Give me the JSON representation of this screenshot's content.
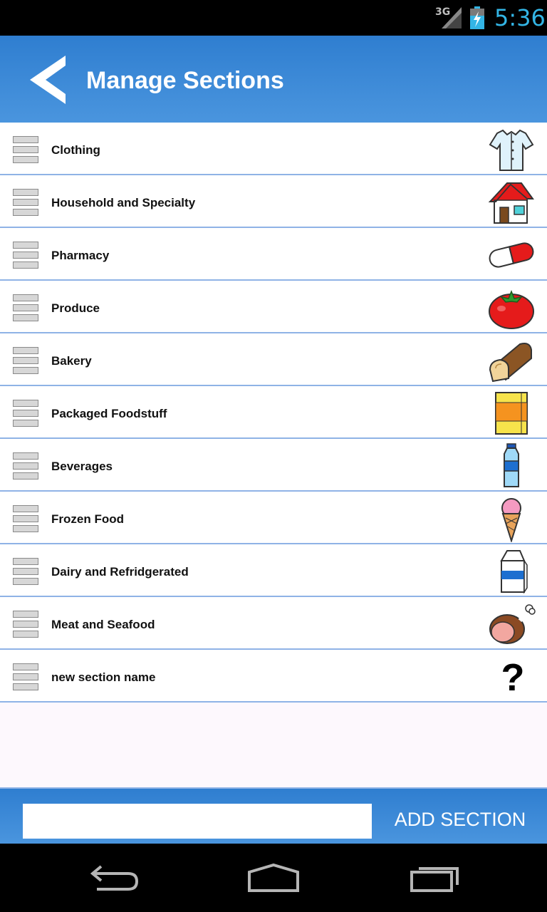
{
  "status": {
    "network": "3G",
    "time": "5:36"
  },
  "header": {
    "title": "Manage Sections",
    "back_icon": "back-arrow-icon"
  },
  "sections": [
    {
      "label": "Clothing",
      "icon": "shirt-icon"
    },
    {
      "label": "Household and Specialty",
      "icon": "house-icon"
    },
    {
      "label": "Pharmacy",
      "icon": "pill-icon"
    },
    {
      "label": "Produce",
      "icon": "tomato-icon"
    },
    {
      "label": "Bakery",
      "icon": "bread-icon"
    },
    {
      "label": "Packaged Foodstuff",
      "icon": "cereal-box-icon"
    },
    {
      "label": "Beverages",
      "icon": "water-bottle-icon"
    },
    {
      "label": "Frozen Food",
      "icon": "ice-cream-icon"
    },
    {
      "label": "Dairy and Refridgerated",
      "icon": "milk-carton-icon"
    },
    {
      "label": "Meat and Seafood",
      "icon": "ham-icon"
    },
    {
      "label": "new section name",
      "icon": "question-mark-icon"
    }
  ],
  "footer": {
    "input_value": "",
    "add_label": "ADD SECTION"
  },
  "nav": {
    "back": "back-icon",
    "home": "home-icon",
    "recents": "recents-icon"
  },
  "colors": {
    "accent": "#3a89d8",
    "status_time": "#33b5e5",
    "divider": "#8fb3e6"
  }
}
